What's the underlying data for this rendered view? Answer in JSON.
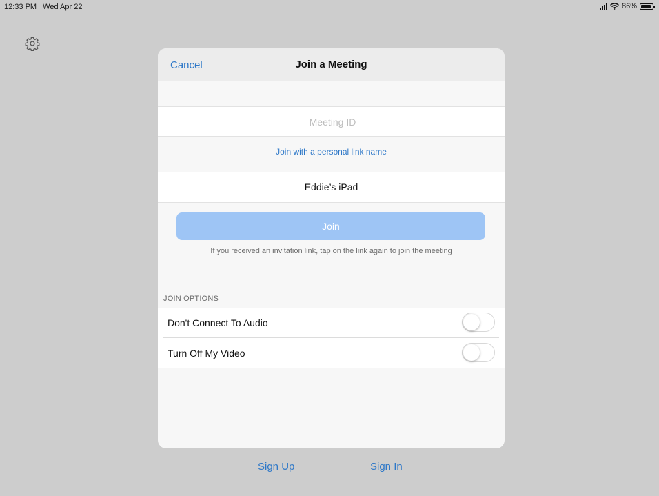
{
  "status_bar": {
    "time": "12:33 PM",
    "date": "Wed Apr 22",
    "battery_percent": "86%",
    "battery_level": 0.86
  },
  "settings": {
    "icon": "gear-icon"
  },
  "dialog": {
    "title": "Join a Meeting",
    "cancel_label": "Cancel",
    "meeting_id": {
      "placeholder": "Meeting ID",
      "value": ""
    },
    "personal_link_label": "Join with a personal link name",
    "display_name": "Eddie’s iPad",
    "join_label": "Join",
    "hint": "If you received an invitation link, tap on the link again to join the meeting",
    "join_options": {
      "header": "JOIN OPTIONS",
      "items": [
        {
          "label": "Don't Connect To Audio",
          "enabled": false
        },
        {
          "label": "Turn Off My Video",
          "enabled": false
        }
      ]
    }
  },
  "footer": {
    "sign_up_label": "Sign Up",
    "sign_in_label": "Sign In"
  },
  "colors": {
    "accent": "#2e78c8",
    "join_button_disabled": "#9ec5f5",
    "backdrop": "#cdcdcd"
  }
}
